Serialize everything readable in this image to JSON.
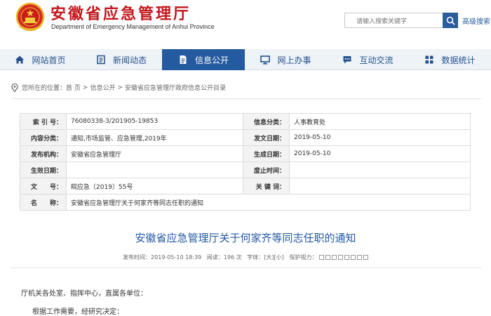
{
  "header": {
    "title": "安徽省应急管理厅",
    "subtitle": "Department of Emergency Management of Anhui Province",
    "search_placeholder": "请输入搜索关键字",
    "advanced_search": "高级搜索"
  },
  "nav": {
    "items": [
      {
        "label": "网站首页",
        "icon": "home-icon"
      },
      {
        "label": "新闻动态",
        "icon": "news-icon"
      },
      {
        "label": "信息公开",
        "icon": "document-icon",
        "active": true
      },
      {
        "label": "网上办事",
        "icon": "monitor-icon"
      },
      {
        "label": "互动交流",
        "icon": "chat-icon"
      },
      {
        "label": "数据统计",
        "icon": "grid-icon"
      }
    ]
  },
  "breadcrumb": {
    "prefix": "您所在的位置：",
    "items": [
      "首 页",
      "信息公开",
      "安徽省应急管理厅政府信息公开目录"
    ],
    "separator": ">"
  },
  "info": {
    "index_label": "索 引 号：",
    "index_value": "76080338-3/201905-19853",
    "category_label": "信息分类：",
    "category_value": "人事教育处",
    "content_label": "内容分类：",
    "content_value": "通知,市场监管、应急管理,2019年",
    "issue_date_label": "发文日期：",
    "issue_date_value": "2019-05-10",
    "publisher_label": "发布机构：",
    "publisher_value": "安徽省应急管理厅",
    "effective_date_label": "生成日期：",
    "effective_date_value": "2019-05-10",
    "valid_date_label": "生效日期：",
    "valid_date_value": "",
    "abolish_date_label": "废止时间：",
    "abolish_date_value": "",
    "doc_no_label": "文　　号：",
    "doc_no_value": "皖应急〔2019〕55号",
    "keywords_label": "关 键 词：",
    "keywords_value": "",
    "name_label": "名　　称：",
    "name_value": "安徽省应急管理厅关于何家齐等同志任职的通知"
  },
  "article": {
    "title": "安徽省应急管理厅关于何家齐等同志任职的通知",
    "published": "发布时间：2019-05-10 18:39",
    "views": "阅读：196 次",
    "font_label": "字体：",
    "font_large": "[大]",
    "font_small": "[小]",
    "eye_protect": "保护视力：",
    "para1": "厅机关各处室、指挥中心，直属各单位：",
    "para2": "根据工作需要，经研究决定："
  },
  "colors": {
    "brand_red": "#c4161c",
    "nav_blue": "#245a9f",
    "title_blue": "#2459a4",
    "nav_bg": "#eef3f8"
  }
}
